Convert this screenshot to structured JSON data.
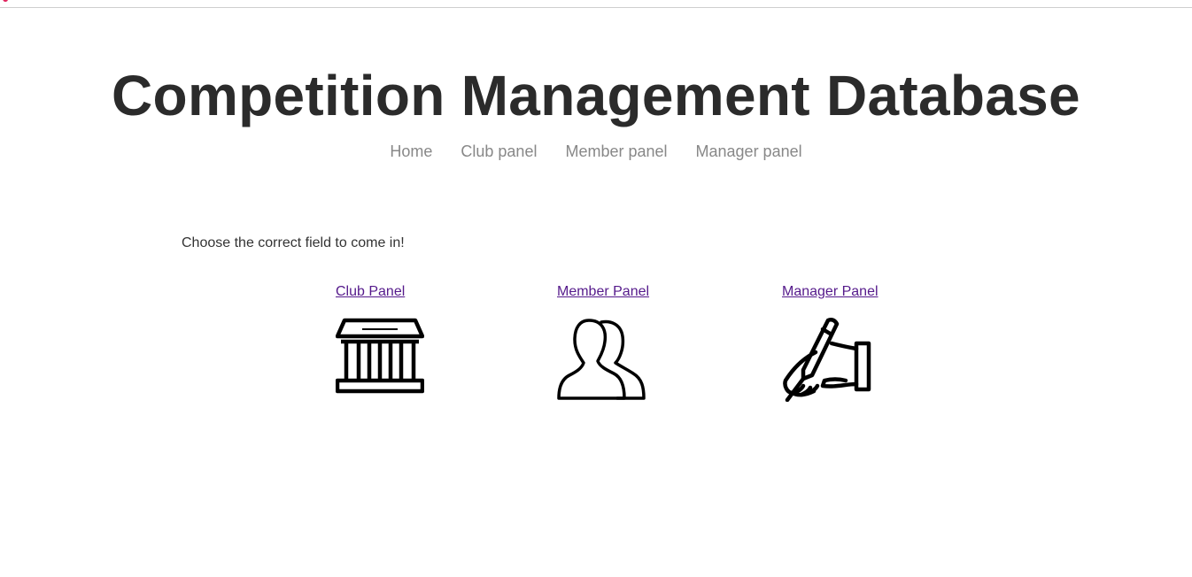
{
  "header": {
    "title": "Competition Management Database"
  },
  "nav": {
    "items": [
      {
        "label": "Home"
      },
      {
        "label": "Club panel"
      },
      {
        "label": "Member panel"
      },
      {
        "label": "Manager panel"
      }
    ]
  },
  "main": {
    "intro": "Choose the correct field to come in!",
    "panels": [
      {
        "label": "Club Panel",
        "icon": "building-icon"
      },
      {
        "label": "Member Panel",
        "icon": "users-icon"
      },
      {
        "label": "Manager Panel",
        "icon": "hand-writing-icon"
      }
    ]
  },
  "colors": {
    "title": "#2b2b2b",
    "nav_link": "#888888",
    "visited_link": "#551a8b",
    "top_fragment": "#e0245e"
  }
}
